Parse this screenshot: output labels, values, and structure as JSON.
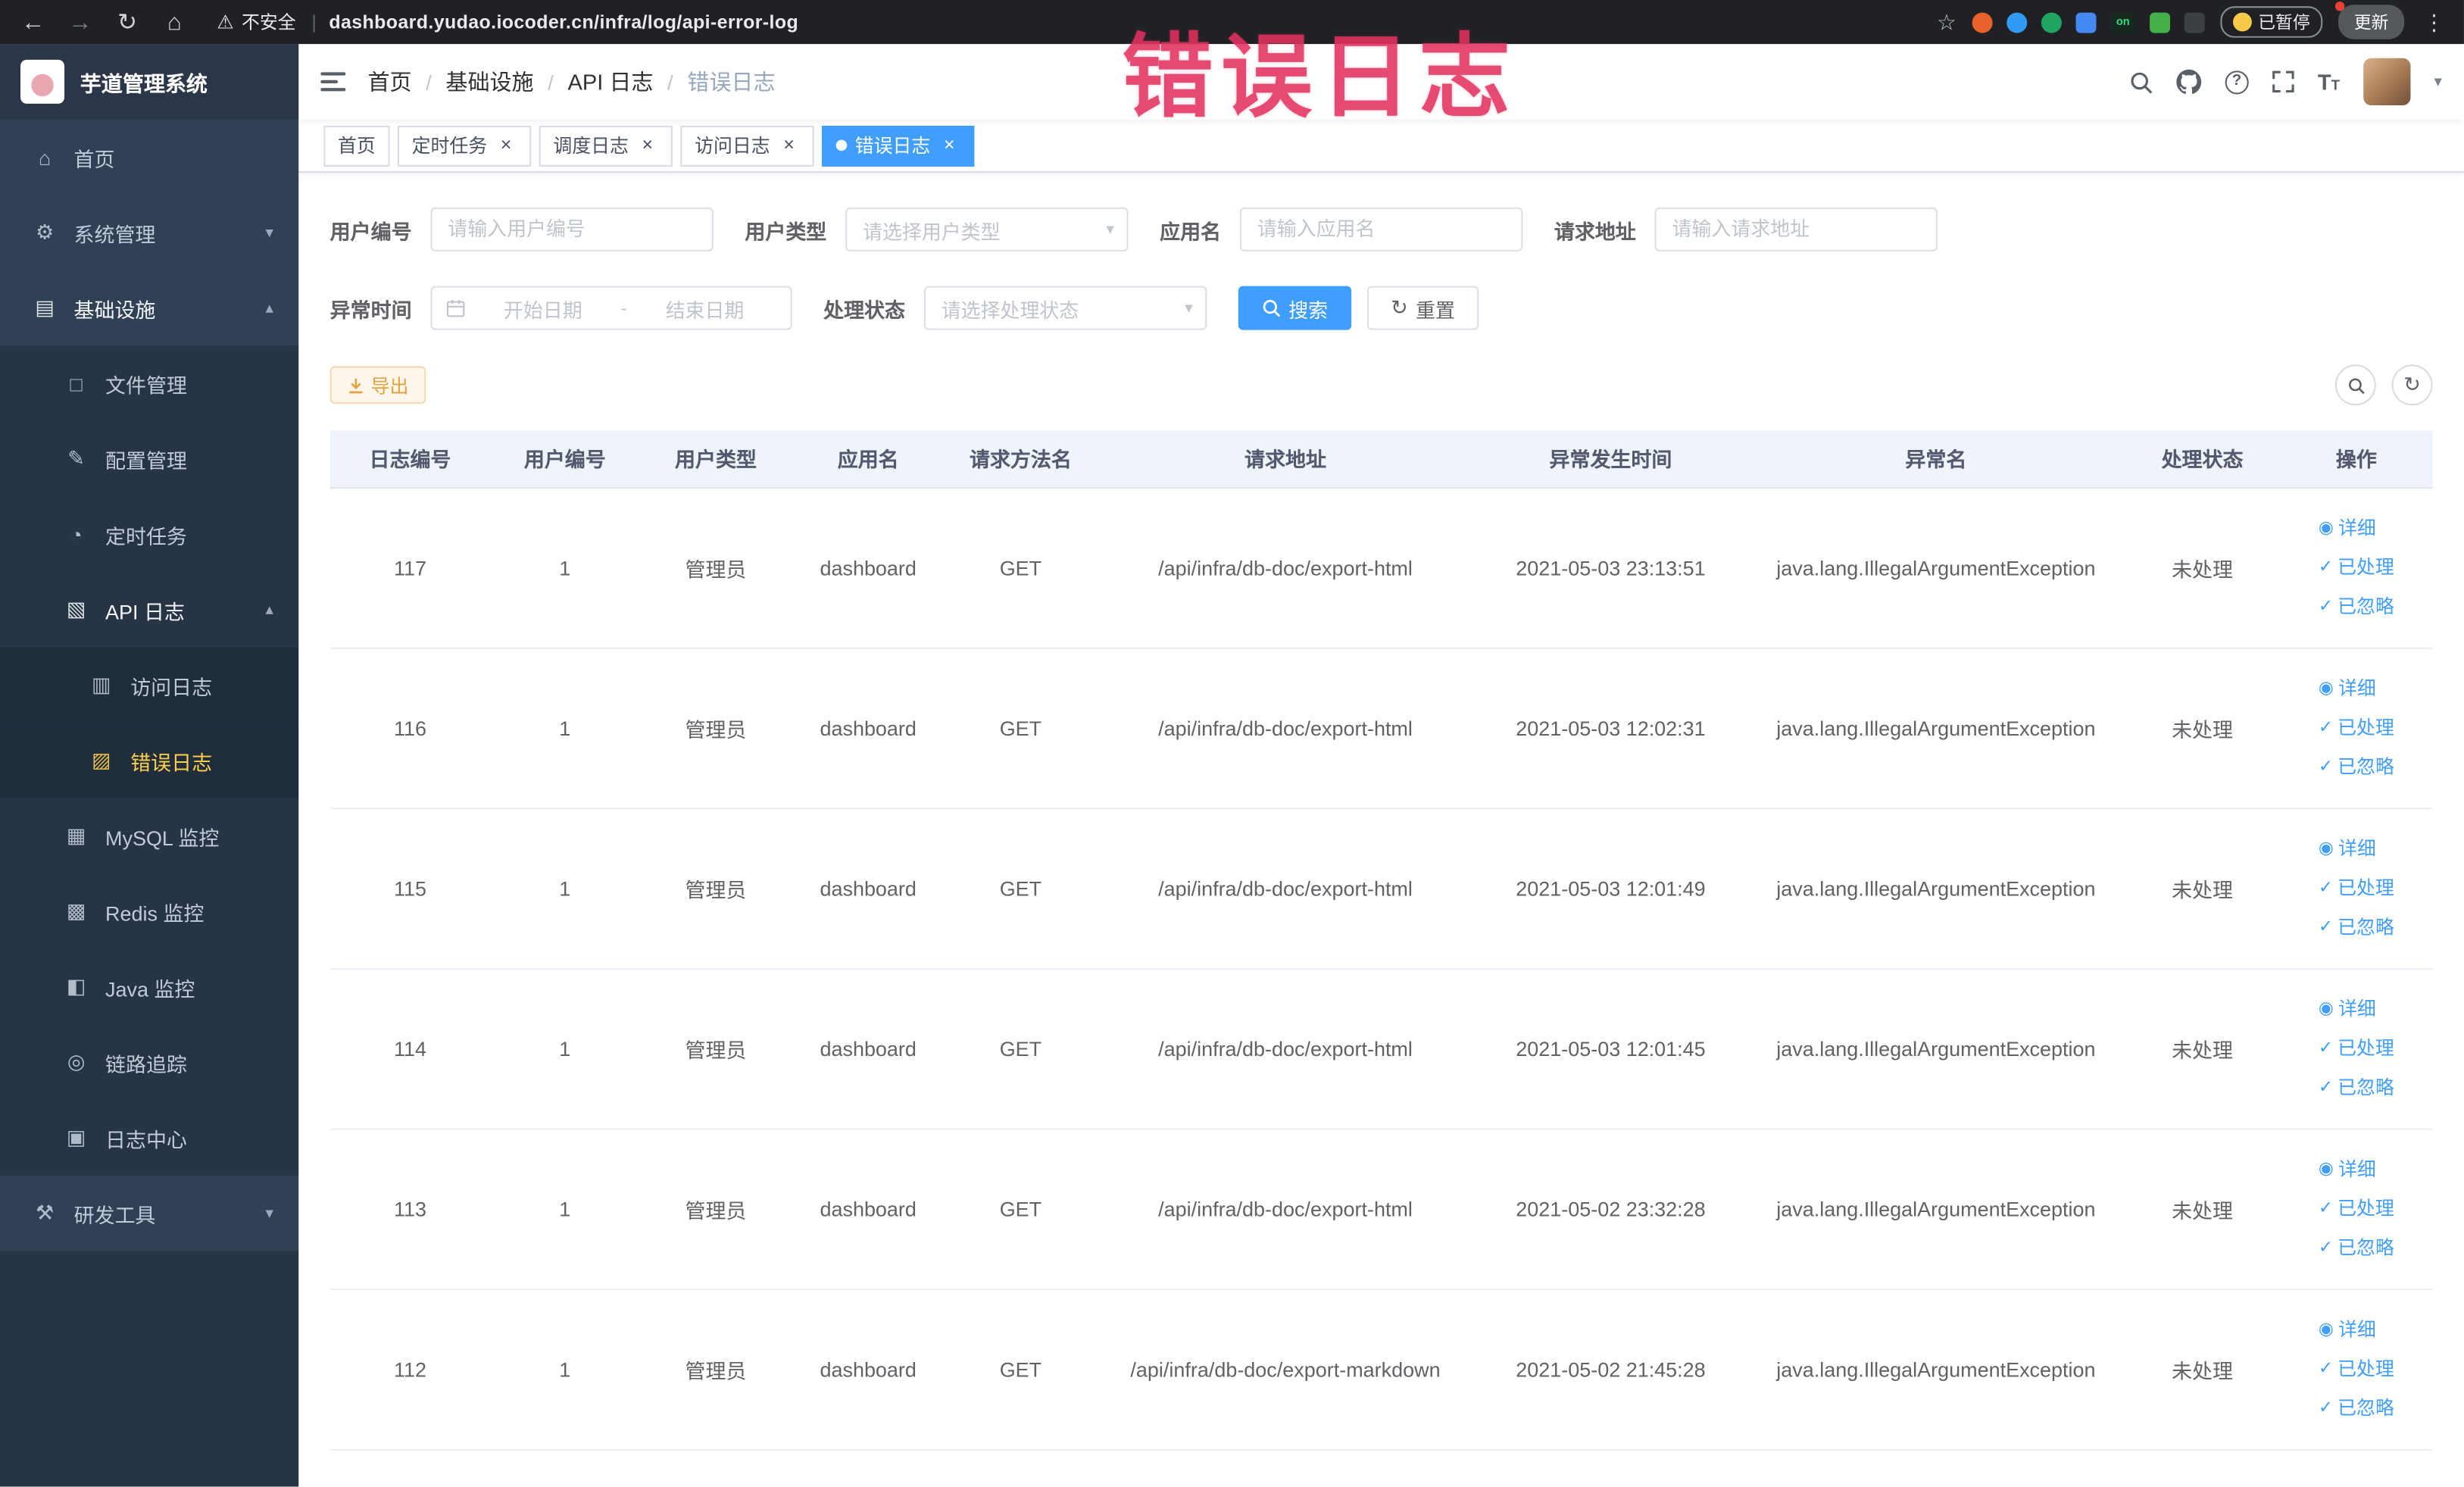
{
  "browser": {
    "security_label": "不安全",
    "url": "dashboard.yudao.iocoder.cn/infra/log/api-error-log",
    "paused_label": "已暂停",
    "update_label": "更新",
    "extensions": [
      {
        "name": "extension-orange",
        "color": "#e8622c",
        "shape": "circle"
      },
      {
        "name": "extension-blue-drop",
        "color": "#2f9bf4",
        "shape": "circle"
      },
      {
        "name": "extension-green-circle",
        "color": "#21a662",
        "shape": "circle"
      },
      {
        "name": "extension-blue-grid",
        "color": "#4688f1",
        "shape": "square"
      },
      {
        "name": "extension-on-badge",
        "color": "#17281f",
        "shape": "badge",
        "label": "on"
      },
      {
        "name": "extension-green-leaf",
        "color": "#43b04a",
        "shape": "square"
      },
      {
        "name": "extension-paw",
        "color": "#3d4043",
        "shape": "square"
      }
    ]
  },
  "annotation": {
    "text": "错误日志",
    "color": "#e3325f"
  },
  "theme": {
    "accent": "#409eff",
    "sidebar_bg": "#304156",
    "active_menu": "#ffd04b",
    "warning": "#e6a23c"
  },
  "sidebar": {
    "logo_title": "芋道管理系统",
    "items": [
      {
        "key": "home",
        "label": "首页",
        "icon": "home-icon",
        "depth": 0
      },
      {
        "key": "system-manage",
        "label": "系统管理",
        "icon": "gear-icon",
        "depth": 0,
        "chevron": "down"
      },
      {
        "key": "infrastructure",
        "label": "基础设施",
        "icon": "infrastructure-icon",
        "depth": 0,
        "chevron": "up",
        "bright": true
      },
      {
        "key": "file-manage",
        "label": "文件管理",
        "icon": "file-manage-icon",
        "depth": 1
      },
      {
        "key": "config-manage",
        "label": "配置管理",
        "icon": "config-manage-icon",
        "depth": 1
      },
      {
        "key": "scheduled-job",
        "label": "定时任务",
        "icon": "scheduled-job-icon",
        "depth": 1
      },
      {
        "key": "api-log",
        "label": "API 日志",
        "icon": "api-log-icon",
        "depth": 1,
        "chevron": "up",
        "bright": true
      },
      {
        "key": "access-log",
        "label": "访问日志",
        "icon": "access-log-icon",
        "depth": 2
      },
      {
        "key": "error-log",
        "label": "错误日志",
        "icon": "error-log-icon",
        "depth": 2,
        "active": true
      },
      {
        "key": "mysql-monitor",
        "label": "MySQL 监控",
        "icon": "mysql-monitor-icon",
        "depth": 1
      },
      {
        "key": "redis-monitor",
        "label": "Redis 监控",
        "icon": "redis-monitor-icon",
        "depth": 1
      },
      {
        "key": "java-monitor",
        "label": "Java 监控",
        "icon": "java-monitor-icon",
        "depth": 1
      },
      {
        "key": "trace",
        "label": "链路追踪",
        "icon": "trace-icon",
        "depth": 1
      },
      {
        "key": "log-center",
        "label": "日志中心",
        "icon": "log-center-icon",
        "depth": 1
      },
      {
        "key": "dev-tools",
        "label": "研发工具",
        "icon": "dev-tools-icon",
        "depth": 0,
        "chevron": "down"
      }
    ]
  },
  "header": {
    "breadcrumb": [
      "首页",
      "基础设施",
      "API 日志",
      "错误日志"
    ]
  },
  "tabs": [
    {
      "key": "home",
      "label": "首页",
      "closable": false,
      "active": false
    },
    {
      "key": "scheduled-job",
      "label": "定时任务",
      "closable": true,
      "active": false
    },
    {
      "key": "schedule-log",
      "label": "调度日志",
      "closable": true,
      "active": false
    },
    {
      "key": "access-log",
      "label": "访问日志",
      "closable": true,
      "active": false
    },
    {
      "key": "error-log",
      "label": "错误日志",
      "closable": true,
      "active": true
    }
  ],
  "filters": {
    "user_id_label": "用户编号",
    "user_id_placeholder": "请输入用户编号",
    "user_type_label": "用户类型",
    "user_type_placeholder": "请选择用户类型",
    "app_name_label": "应用名",
    "app_name_placeholder": "请输入应用名",
    "request_url_label": "请求地址",
    "request_url_placeholder": "请输入请求地址",
    "exception_time_label": "异常时间",
    "date_start_placeholder": "开始日期",
    "date_separator": "-",
    "date_end_placeholder": "结束日期",
    "process_status_label": "处理状态",
    "process_status_placeholder": "请选择处理状态",
    "search_label": "搜索",
    "reset_label": "重置"
  },
  "toolbar": {
    "export_label": "导出"
  },
  "table": {
    "columns": [
      "日志编号",
      "用户编号",
      "用户类型",
      "应用名",
      "请求方法名",
      "请求地址",
      "异常发生时间",
      "异常名",
      "处理状态",
      "操作"
    ],
    "rows": [
      {
        "log_id": "117",
        "user_id": "1",
        "user_type": "管理员",
        "app_name": "dashboard",
        "method": "GET",
        "request_url": "/api/infra/db-doc/export-html",
        "time": "2021-05-03 23:13:51",
        "exception_name": "java.lang.IllegalArgumentException",
        "status": "未处理"
      },
      {
        "log_id": "116",
        "user_id": "1",
        "user_type": "管理员",
        "app_name": "dashboard",
        "method": "GET",
        "request_url": "/api/infra/db-doc/export-html",
        "time": "2021-05-03 12:02:31",
        "exception_name": "java.lang.IllegalArgumentException",
        "status": "未处理"
      },
      {
        "log_id": "115",
        "user_id": "1",
        "user_type": "管理员",
        "app_name": "dashboard",
        "method": "GET",
        "request_url": "/api/infra/db-doc/export-html",
        "time": "2021-05-03 12:01:49",
        "exception_name": "java.lang.IllegalArgumentException",
        "status": "未处理"
      },
      {
        "log_id": "114",
        "user_id": "1",
        "user_type": "管理员",
        "app_name": "dashboard",
        "method": "GET",
        "request_url": "/api/infra/db-doc/export-html",
        "time": "2021-05-03 12:01:45",
        "exception_name": "java.lang.IllegalArgumentException",
        "status": "未处理"
      },
      {
        "log_id": "113",
        "user_id": "1",
        "user_type": "管理员",
        "app_name": "dashboard",
        "method": "GET",
        "request_url": "/api/infra/db-doc/export-html",
        "time": "2021-05-02 23:32:28",
        "exception_name": "java.lang.IllegalArgumentException",
        "status": "未处理"
      },
      {
        "log_id": "112",
        "user_id": "1",
        "user_type": "管理员",
        "app_name": "dashboard",
        "method": "GET",
        "request_url": "/api/infra/db-doc/export-markdown",
        "time": "2021-05-02 21:45:28",
        "exception_name": "java.lang.IllegalArgumentException",
        "status": "未处理"
      }
    ],
    "row_actions": [
      {
        "label": "详细",
        "icon": "eye-icon"
      },
      {
        "label": "已处理",
        "icon": "check-icon"
      },
      {
        "label": "已忽略",
        "icon": "check-icon"
      }
    ]
  }
}
